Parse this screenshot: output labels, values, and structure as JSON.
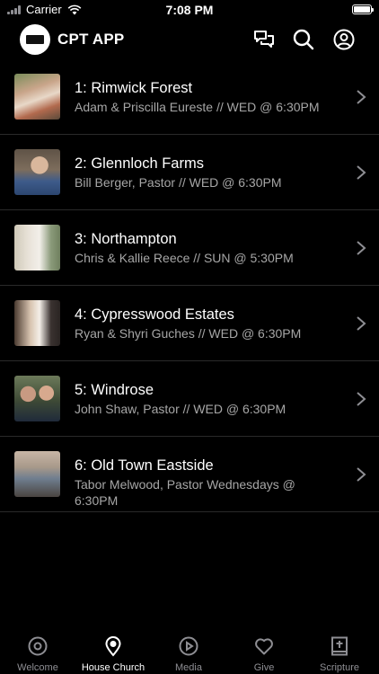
{
  "status_bar": {
    "carrier": "Carrier",
    "time": "7:08 PM"
  },
  "header": {
    "logo_text": "CHURCH",
    "title": "CPT APP",
    "icons": [
      "chat-bubbles-icon",
      "search-icon",
      "account-icon"
    ]
  },
  "churches": [
    {
      "title": "1: Rimwick Forest",
      "subtitle": "Adam & Priscilla Eureste // WED @ 6:30PM"
    },
    {
      "title": "2: Glennloch Farms",
      "subtitle": "Bill Berger, Pastor // WED @ 6:30PM"
    },
    {
      "title": "3: Northampton",
      "subtitle": "Chris & Kallie Reece // SUN @ 5:30PM"
    },
    {
      "title": "4: Cypresswood Estates",
      "subtitle": "Ryan & Shyri Guches // WED @ 6:30PM"
    },
    {
      "title": "5: Windrose",
      "subtitle": "John Shaw, Pastor // WED @ 6:30PM"
    },
    {
      "title": "6: Old Town Eastside",
      "subtitle": "Tabor Melwood, Pastor Wednesdays @ 6:30PM"
    }
  ],
  "tabs": [
    {
      "label": "Welcome",
      "icon": "target-icon",
      "active": false
    },
    {
      "label": "House Church",
      "icon": "location-pin-icon",
      "active": true
    },
    {
      "label": "Media",
      "icon": "play-circle-icon",
      "active": false
    },
    {
      "label": "Give",
      "icon": "heart-icon",
      "active": false
    },
    {
      "label": "Scripture",
      "icon": "bible-icon",
      "active": false
    }
  ]
}
